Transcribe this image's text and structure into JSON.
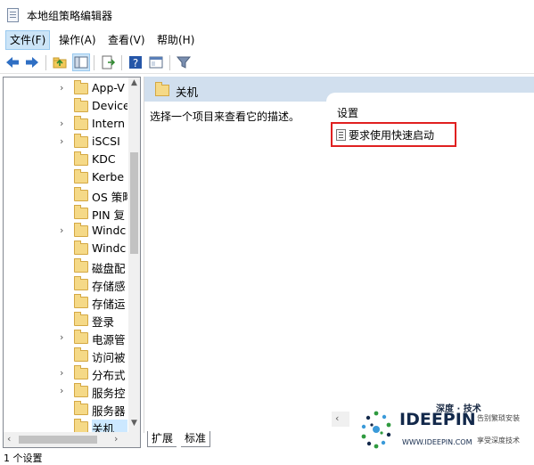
{
  "window": {
    "title": "本地组策略编辑器"
  },
  "menu": [
    {
      "label": "文件(F)"
    },
    {
      "label": "操作(A)"
    },
    {
      "label": "查看(V)"
    },
    {
      "label": "帮助(H)"
    }
  ],
  "tree": {
    "items": [
      {
        "label": "App-V",
        "expandable": true
      },
      {
        "label": "Device",
        "expandable": false
      },
      {
        "label": "Intern",
        "expandable": true
      },
      {
        "label": "iSCSI",
        "expandable": true
      },
      {
        "label": "KDC",
        "expandable": false
      },
      {
        "label": "Kerbe",
        "expandable": false
      },
      {
        "label": "OS 策略",
        "expandable": false
      },
      {
        "label": "PIN 复",
        "expandable": false
      },
      {
        "label": "Windc",
        "expandable": true
      },
      {
        "label": "Windc",
        "expandable": false
      },
      {
        "label": "磁盘配",
        "expandable": false
      },
      {
        "label": "存储感",
        "expandable": false
      },
      {
        "label": "存储运",
        "expandable": false
      },
      {
        "label": "登录",
        "expandable": false
      },
      {
        "label": "电源管",
        "expandable": true
      },
      {
        "label": "访问被",
        "expandable": false
      },
      {
        "label": "分布式",
        "expandable": true
      },
      {
        "label": "服务控",
        "expandable": true
      },
      {
        "label": "服务器",
        "expandable": false
      },
      {
        "label": "关机",
        "expandable": false,
        "selected": true
      }
    ]
  },
  "right": {
    "header": "关机",
    "description": "选择一个项目来查看它的描述。",
    "list_header": "设置",
    "list_item": "要求使用快速启动"
  },
  "tabs": [
    {
      "label": "扩展"
    },
    {
      "label": "标准"
    }
  ],
  "status": {
    "text": "1 个设置"
  },
  "watermark": {
    "title": "深度 · 技术",
    "brand": "IDEEPIN",
    "url": "WWW.IDEEPIN.COM",
    "tag1": "告别繁琐安装",
    "tag2": "享受深度技术"
  }
}
